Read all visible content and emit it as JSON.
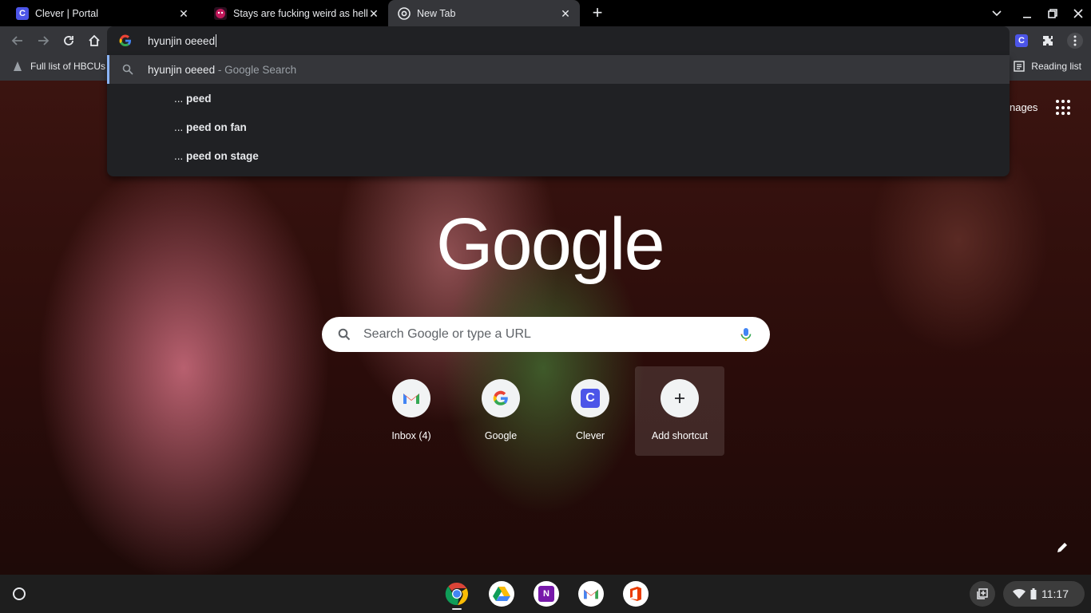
{
  "tabs": [
    {
      "title": "Clever | Portal",
      "favicon": "clever-icon",
      "active": false
    },
    {
      "title": "Stays are fucking weird as hell- -",
      "favicon": "tumblr-style-icon",
      "active": false
    },
    {
      "title": "New Tab",
      "favicon": "chrome-icon",
      "active": true
    }
  ],
  "omnibox": {
    "value": "hyunjin oeeed"
  },
  "suggestions": [
    {
      "query": "hyunjin oeeed",
      "suffix": " - Google Search",
      "icon": "search-icon",
      "selected": true
    },
    {
      "prefix": "...",
      "tail": "peed"
    },
    {
      "prefix": "...",
      "tail": "peed on fan"
    },
    {
      "prefix": "...",
      "tail": "peed on stage"
    }
  ],
  "bookmarks": {
    "items": [
      {
        "label": "Full list of HBCUs"
      }
    ],
    "reading_list": "Reading list"
  },
  "newtab": {
    "images_link": "nages",
    "logo": "Google",
    "search_placeholder": "Search Google or type a URL",
    "shortcuts": [
      {
        "label": "Inbox (4)",
        "icon": "gmail-icon"
      },
      {
        "label": "Google",
        "icon": "google-icon"
      },
      {
        "label": "Clever",
        "icon": "clever-icon"
      },
      {
        "label": "Add shortcut",
        "icon": "plus-icon"
      }
    ]
  },
  "shelf": {
    "apps": [
      "chrome-icon",
      "google-drive-icon",
      "onenote-icon",
      "gmail-icon",
      "office-icon"
    ],
    "time": "11:17"
  },
  "colors": {
    "accent": "#8ab4f8",
    "toolbar": "#35363a",
    "omnibox": "#202124",
    "clever_blue": "#4c55e8"
  }
}
